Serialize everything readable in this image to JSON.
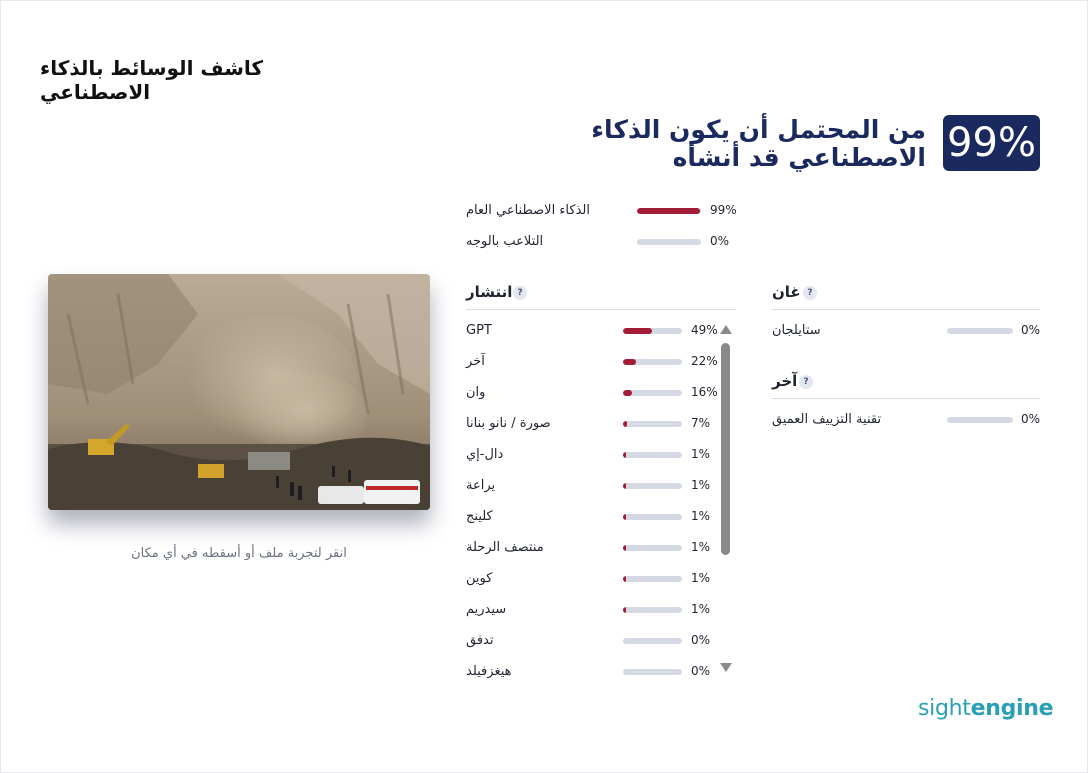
{
  "page": {
    "title": "كاشف الوسائط بالذكاء الاصطناعي"
  },
  "result": {
    "score": "99%",
    "headline": "من المحتمل أن يكون الذكاء الاصطناعي قد أنشأه",
    "overall": [
      {
        "label": "الذكاء الاصطناعي العام",
        "value": "99%",
        "fraction": 0.99
      },
      {
        "label": "التلاعب بالوجه",
        "value": "0%",
        "fraction": 0.0
      }
    ]
  },
  "diffusion": {
    "title": "انتشار",
    "help": "?",
    "items": [
      {
        "label": "GPT",
        "value": "49%",
        "fraction": 0.49
      },
      {
        "label": "آخر",
        "value": "22%",
        "fraction": 0.22
      },
      {
        "label": "وان",
        "value": "16%",
        "fraction": 0.16
      },
      {
        "label": "صورة / نانو بنانا",
        "value": "7%",
        "fraction": 0.07
      },
      {
        "label": "دال-إي",
        "value": "1%",
        "fraction": 0.01
      },
      {
        "label": "يراعة",
        "value": "1%",
        "fraction": 0.01
      },
      {
        "label": "كلينج",
        "value": "1%",
        "fraction": 0.01
      },
      {
        "label": "منتصف الرحلة",
        "value": "1%",
        "fraction": 0.01
      },
      {
        "label": "كوين",
        "value": "1%",
        "fraction": 0.01
      },
      {
        "label": "سيدريم",
        "value": "1%",
        "fraction": 0.01
      },
      {
        "label": "تدفق",
        "value": "0%",
        "fraction": 0.0
      },
      {
        "label": "هيغزفيلد",
        "value": "0%",
        "fraction": 0.0
      }
    ]
  },
  "gan": {
    "title": "غان",
    "help": "?",
    "items": [
      {
        "label": "ستايلجان",
        "value": "0%",
        "fraction": 0.0
      }
    ]
  },
  "other": {
    "title": "آخر",
    "help": "?",
    "items": [
      {
        "label": "تقنية التزييف العميق",
        "value": "0%",
        "fraction": 0.0
      }
    ]
  },
  "upload": {
    "hint": "انقر لتجربة ملف أو أسقطه في أي مكان"
  },
  "brand": {
    "logo_light": "sight",
    "logo_bold": "engine"
  },
  "colors": {
    "accent": "#1b2a5e",
    "bar_fill": "#a31c37",
    "bar_track": "#d4d9e3",
    "brand": "#2aa0b4"
  }
}
